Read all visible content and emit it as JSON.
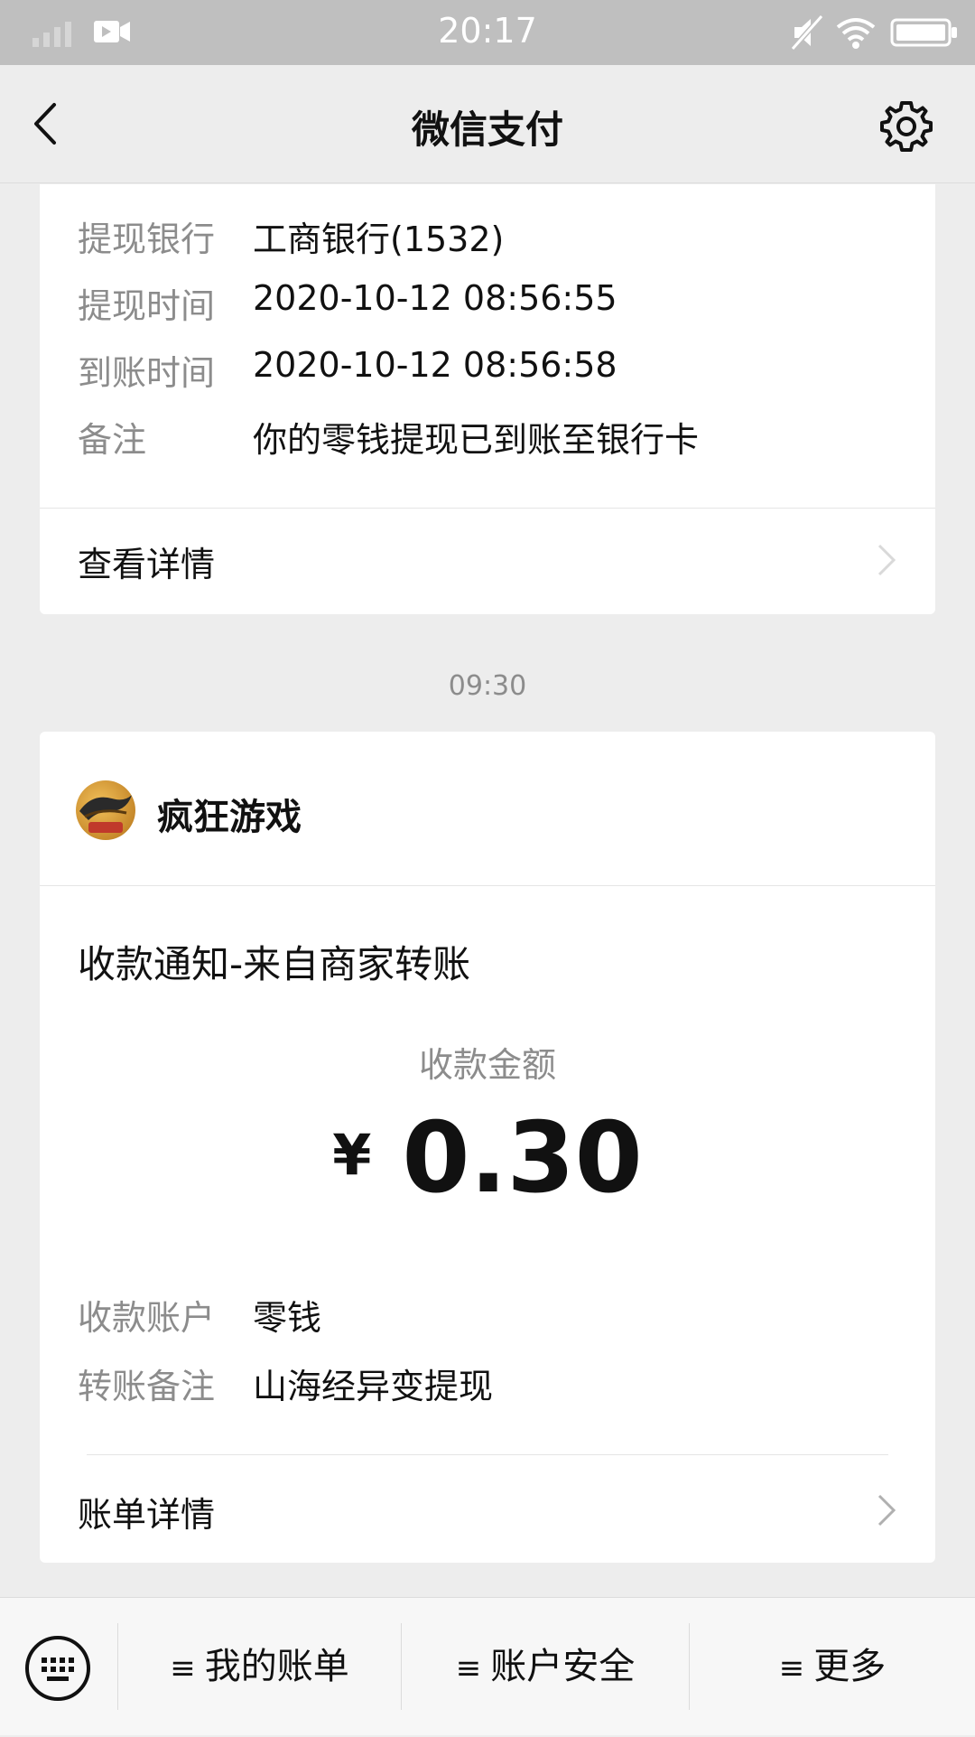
{
  "status_bar": {
    "time": "20:17"
  },
  "header": {
    "title": "微信支付"
  },
  "withdraw_card": {
    "rows": [
      {
        "label": "提现银行",
        "value": "工商银行(1532)"
      },
      {
        "label": "提现时间",
        "value": "2020-10-12 08:56:55"
      },
      {
        "label": "到账时间",
        "value": "2020-10-12 08:56:58"
      },
      {
        "label": "备注",
        "value": "你的零钱提现已到账至银行卡"
      }
    ],
    "link_label": "查看详情"
  },
  "timestamp": "09:30",
  "receipt_card": {
    "merchant_name": "疯狂游戏",
    "notice_title": "收款通知-来自商家转账",
    "amount_label": "收款金额",
    "currency_symbol": "¥",
    "amount": "0.30",
    "rows": [
      {
        "label": "收款账户",
        "value": "零钱"
      },
      {
        "label": "转账备注",
        "value": "山海经异变提现"
      }
    ],
    "link_label": "账单详情"
  },
  "bottom_menu": {
    "items": [
      {
        "glyph": "≡",
        "label": "我的账单"
      },
      {
        "glyph": "≡",
        "label": "账户安全"
      },
      {
        "glyph": "≡",
        "label": "更多"
      }
    ]
  },
  "icons": {
    "back": "back-arrow-icon",
    "settings": "gear-icon",
    "keyboard": "keyboard-icon",
    "chevron": "chevron-right-icon"
  }
}
